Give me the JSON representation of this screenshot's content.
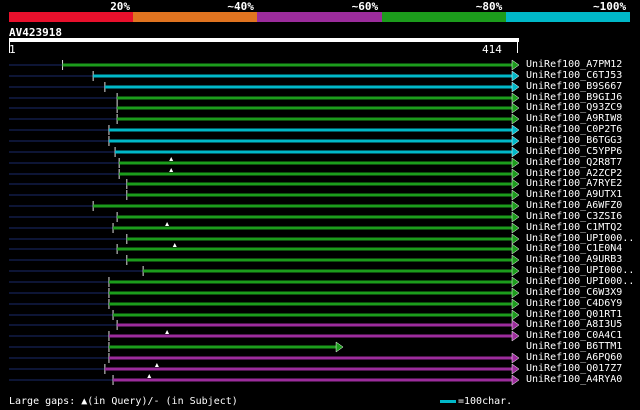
{
  "legend": {
    "segments": [
      {
        "label": "20%",
        "color": "#e8102c"
      },
      {
        "label": "~40%",
        "color": "#e07420"
      },
      {
        "label": "~60%",
        "color": "#9c2c9c"
      },
      {
        "label": "~80%",
        "color": "#1c9c1c"
      },
      {
        "label": "~100%",
        "color": "#00b8c8"
      }
    ]
  },
  "query": {
    "name": "AV423918",
    "start": "1",
    "end": "414"
  },
  "hits": [
    {
      "name": "UniRef100_A7PM12",
      "color": "#1c9c1c",
      "start": 0.105,
      "gap": null
    },
    {
      "name": "UniRef100_C6TJ53",
      "color": "#00b8c8",
      "start": 0.165,
      "gap": null
    },
    {
      "name": "UniRef100_B9S667",
      "color": "#00b8c8",
      "start": 0.188,
      "gap": null
    },
    {
      "name": "UniRef100_B9GIJ6",
      "color": "#1c9c1c",
      "start": 0.212,
      "gap": null
    },
    {
      "name": "UniRef100_Q93ZC9",
      "color": "#1c9c1c",
      "start": 0.212,
      "gap": null
    },
    {
      "name": "UniRef100_A9RIW8",
      "color": "#1c9c1c",
      "start": 0.212,
      "gap": null
    },
    {
      "name": "UniRef100_C0P2T6",
      "color": "#00b8c8",
      "start": 0.196,
      "gap": null
    },
    {
      "name": "UniRef100_B6TGG3",
      "color": "#00b8c8",
      "start": 0.196,
      "gap": null
    },
    {
      "name": "UniRef100_C5YPP6",
      "color": "#00b8c8",
      "start": 0.208,
      "gap": null
    },
    {
      "name": "UniRef100_Q2R8T7",
      "color": "#1c9c1c",
      "start": 0.216,
      "gap": 0.318
    },
    {
      "name": "UniRef100_A2ZCP2",
      "color": "#1c9c1c",
      "start": 0.216,
      "gap": 0.318
    },
    {
      "name": "UniRef100_A7RYE2",
      "color": "#1c9c1c",
      "start": 0.231,
      "gap": null
    },
    {
      "name": "UniRef100_A9UTX1",
      "color": "#1c9c1c",
      "start": 0.231,
      "gap": null
    },
    {
      "name": "UniRef100_A6WFZ0",
      "color": "#1c9c1c",
      "start": 0.165,
      "gap": null
    },
    {
      "name": "UniRef100_C3ZSI6",
      "color": "#1c9c1c",
      "start": 0.212,
      "gap": null
    },
    {
      "name": "UniRef100_C1MTQ2",
      "color": "#1c9c1c",
      "start": 0.204,
      "gap": 0.31
    },
    {
      "name": "UniRef100_UPI000..",
      "color": "#1c9c1c",
      "start": 0.231,
      "gap": null
    },
    {
      "name": "UniRef100_C1E0N4",
      "color": "#1c9c1c",
      "start": 0.212,
      "gap": 0.325
    },
    {
      "name": "UniRef100_A9URB3",
      "color": "#1c9c1c",
      "start": 0.231,
      "gap": null
    },
    {
      "name": "UniRef100_UPI000..",
      "color": "#1c9c1c",
      "start": 0.263,
      "gap": null
    },
    {
      "name": "UniRef100_UPI000..",
      "color": "#1c9c1c",
      "start": 0.196,
      "gap": null
    },
    {
      "name": "UniRef100_C6W3X9",
      "color": "#1c9c1c",
      "start": 0.196,
      "gap": null
    },
    {
      "name": "UniRef100_C4D6Y9",
      "color": "#1c9c1c",
      "start": 0.196,
      "gap": null
    },
    {
      "name": "UniRef100_Q01RT1",
      "color": "#1c9c1c",
      "start": 0.204,
      "gap": null
    },
    {
      "name": "UniRef100_A8I3U5",
      "color": "#9c2c9c",
      "start": 0.212,
      "gap": null
    },
    {
      "name": "UniRef100_C0A4C1",
      "color": "#9c2c9c",
      "start": 0.196,
      "gap": 0.31
    },
    {
      "name": "UniRef100_B6TTM1",
      "color": "#1c9c1c",
      "start": 0.196,
      "gap": null,
      "end": 0.655
    },
    {
      "name": "UniRef100_A6PQ60",
      "color": "#9c2c9c",
      "start": 0.196,
      "gap": null
    },
    {
      "name": "UniRef100_Q017Z7",
      "color": "#9c2c9c",
      "start": 0.188,
      "gap": 0.29
    },
    {
      "name": "UniRef100_A4RYA0",
      "color": "#9c2c9c",
      "start": 0.204,
      "gap": 0.275
    }
  ],
  "footer": {
    "gaps_text": "Large gaps: ▲(in Query)/- (in Subject)",
    "scale_text": "=100char."
  }
}
